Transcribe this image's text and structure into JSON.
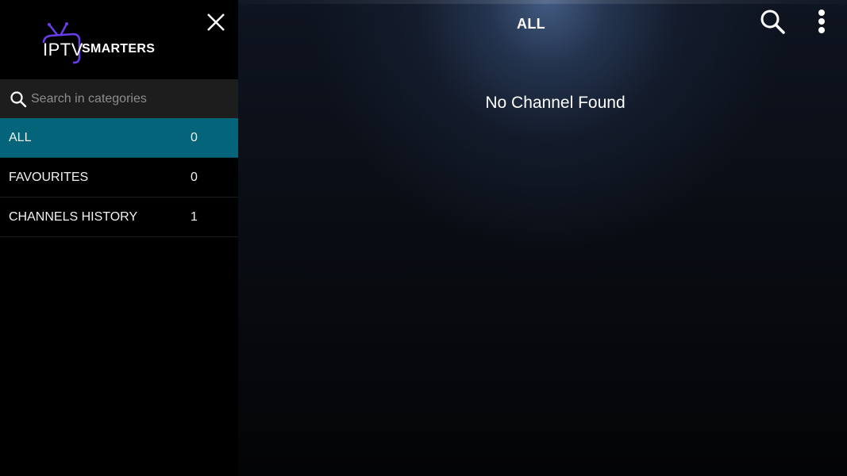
{
  "app": {
    "logo_left": "IPTV",
    "logo_right": "SMARTERS"
  },
  "header": {
    "title": "ALL",
    "icons": [
      "search-icon",
      "more-vert-icon"
    ]
  },
  "sidebar": {
    "close_icon": "close-icon",
    "search": {
      "placeholder": "Search in categories",
      "value": "",
      "icon": "search-icon"
    },
    "categories": [
      {
        "label": "ALL",
        "count": "0",
        "active": true
      },
      {
        "label": "FAVOURITES",
        "count": "0",
        "active": false
      },
      {
        "label": "CHANNELS HISTORY",
        "count": "1",
        "active": false
      }
    ]
  },
  "main": {
    "empty_message": "No Channel Found"
  },
  "colors": {
    "accent": "#04647a",
    "search_bg": "#1d1d1d",
    "logo_purple": "#6a3de8"
  }
}
